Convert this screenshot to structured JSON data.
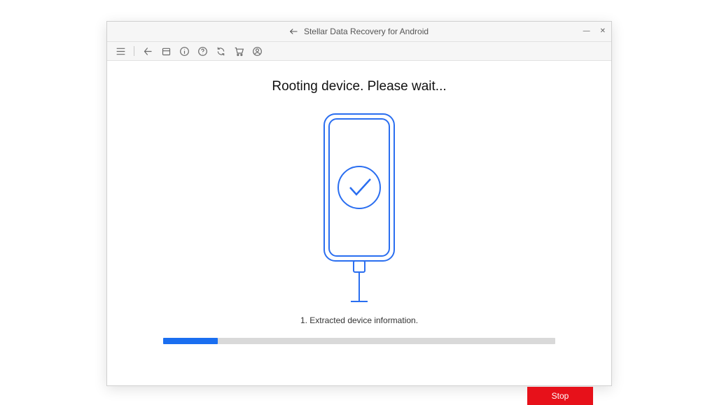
{
  "window": {
    "title": "Stellar Data Recovery for Android"
  },
  "main": {
    "heading": "Rooting device. Please wait...",
    "status": "1. Extracted device information.",
    "stop_label": "Stop"
  },
  "progress": {
    "percent": 14
  },
  "colors": {
    "accent": "#1a6ef0",
    "danger": "#e7111a"
  }
}
